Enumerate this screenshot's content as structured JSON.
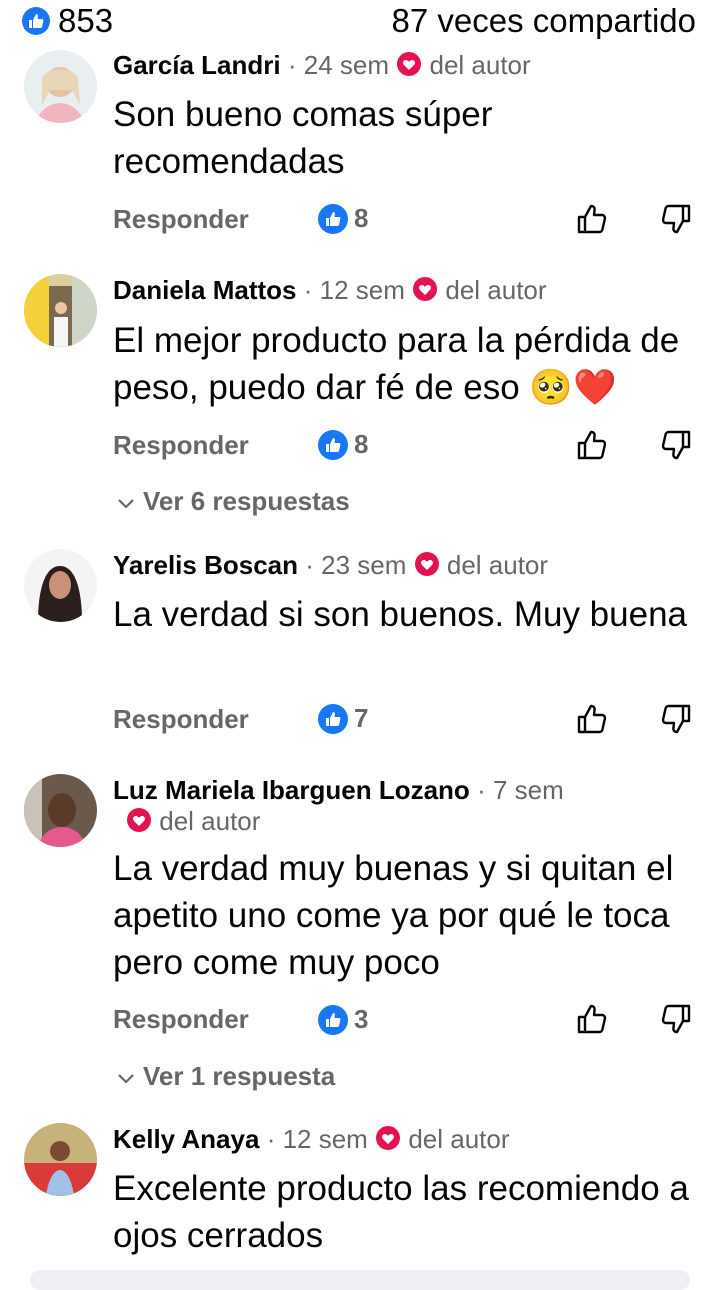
{
  "header": {
    "likes": "853",
    "shares": "87 veces compartido"
  },
  "comments": [
    {
      "name": "García Landri",
      "time": "· 24 sem",
      "author_tag": "del autor",
      "text": "Son bueno comas súper recomendadas",
      "reply_label": "Responder",
      "reactions": "8"
    },
    {
      "name": "Daniela Mattos",
      "time": "· 12 sem",
      "author_tag": "del autor",
      "text": "El mejor producto para la pérdida de peso, puedo dar fé de eso 🥺❤️",
      "reply_label": "Responder",
      "reactions": "8",
      "view_replies": "Ver 6 respuestas"
    },
    {
      "name": "Yarelis Boscan",
      "time": "· 23 sem",
      "author_tag": "del autor",
      "text": "La verdad si son buenos. Muy buena",
      "reply_label": "Responder",
      "reactions": "7"
    },
    {
      "name": "Luz Mariela Ibarguen Lozano",
      "time": "· 7 sem",
      "author_tag": "del autor",
      "text": "La verdad muy buenas y si quitan el apetito uno come ya por qué le toca pero come muy poco",
      "reply_label": "Responder",
      "reactions": "3",
      "view_replies": "Ver 1 respuesta"
    },
    {
      "name": "Kelly Anaya",
      "time": "· 12 sem",
      "author_tag": "del autor",
      "text": "Excelente producto las recomiendo a ojos cerrados"
    }
  ],
  "colors": {
    "brand": "#1877f2",
    "author_heart": "#e4134f",
    "muted": "#65676b"
  }
}
